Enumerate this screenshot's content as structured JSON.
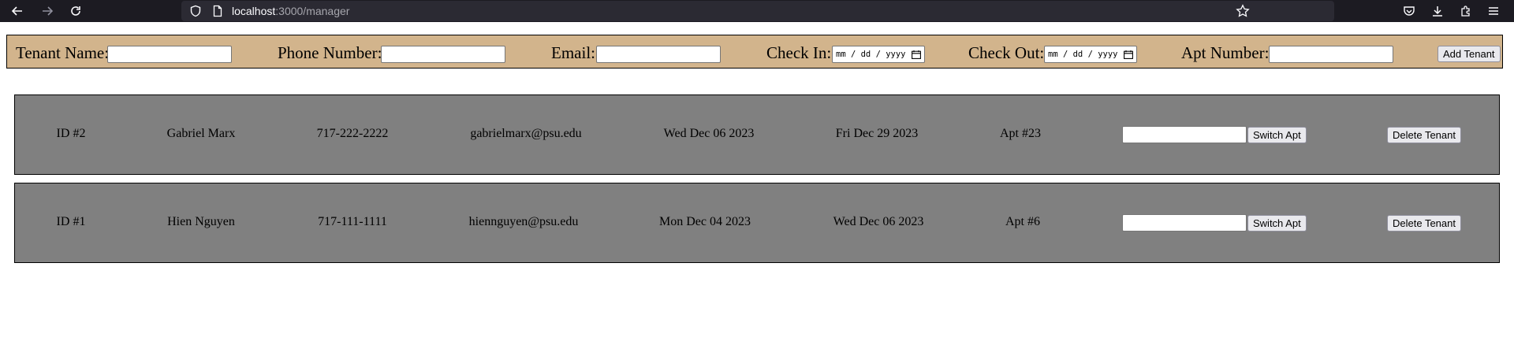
{
  "browser": {
    "url_host": "localhost",
    "url_path": ":3000/manager"
  },
  "form": {
    "tenant_name_label": "Tenant Name:",
    "phone_label": "Phone Number:",
    "email_label": "Email:",
    "check_in_label": "Check In:",
    "check_out_label": "Check Out:",
    "apt_label": "Apt Number:",
    "date_placeholder": "mm / dd / yyyy",
    "add_button": "Add Tenant"
  },
  "tenants": [
    {
      "id": "ID #2",
      "name": "Gabriel Marx",
      "phone": "717-222-2222",
      "email": "gabrielmarx@psu.edu",
      "check_in": "Wed Dec 06 2023",
      "check_out": "Fri Dec 29 2023",
      "apt": "Apt #23",
      "switch_label": "Switch Apt",
      "delete_label": "Delete Tenant"
    },
    {
      "id": "ID #1",
      "name": "Hien Nguyen",
      "phone": "717-111-1111",
      "email": "hiennguyen@psu.edu",
      "check_in": "Mon Dec 04 2023",
      "check_out": "Wed Dec 06 2023",
      "apt": "Apt #6",
      "switch_label": "Switch Apt",
      "delete_label": "Delete Tenant"
    }
  ],
  "colors": {
    "form_bg": "#d2b48c",
    "row_bg": "#808080",
    "chrome_bg": "#1c1b22",
    "urlbar_bg": "#2b2a33"
  },
  "icons": {
    "back": "back-arrow-icon",
    "forward": "forward-arrow-icon",
    "reload": "reload-icon",
    "shield": "shield-icon",
    "page": "page-icon",
    "bookmark": "star-icon",
    "pocket": "pocket-icon",
    "downloads": "download-icon",
    "extensions": "extensions-icon",
    "menu": "hamburger-menu-icon",
    "calendar": "calendar-icon"
  }
}
